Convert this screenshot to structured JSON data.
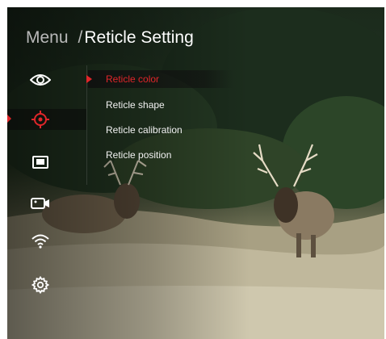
{
  "header": {
    "parent": "Menu",
    "separator": "/",
    "title": "Reticle Setting"
  },
  "sidebar": {
    "items": [
      {
        "icon": "eye-icon"
      },
      {
        "icon": "reticle-target-icon",
        "active": true
      },
      {
        "icon": "display-picture-icon"
      },
      {
        "icon": "video-camera-icon"
      },
      {
        "icon": "wifi-icon"
      },
      {
        "icon": "gear-icon"
      }
    ]
  },
  "submenu": {
    "items": [
      {
        "label": "Reticle color",
        "active": true
      },
      {
        "label": "Reticle shape"
      },
      {
        "label": "Reticle calibration"
      },
      {
        "label": "Reticle position"
      }
    ]
  },
  "colors": {
    "accent": "#e0262a",
    "text": "#f2f2f2",
    "muted": "#b9b9b9"
  }
}
